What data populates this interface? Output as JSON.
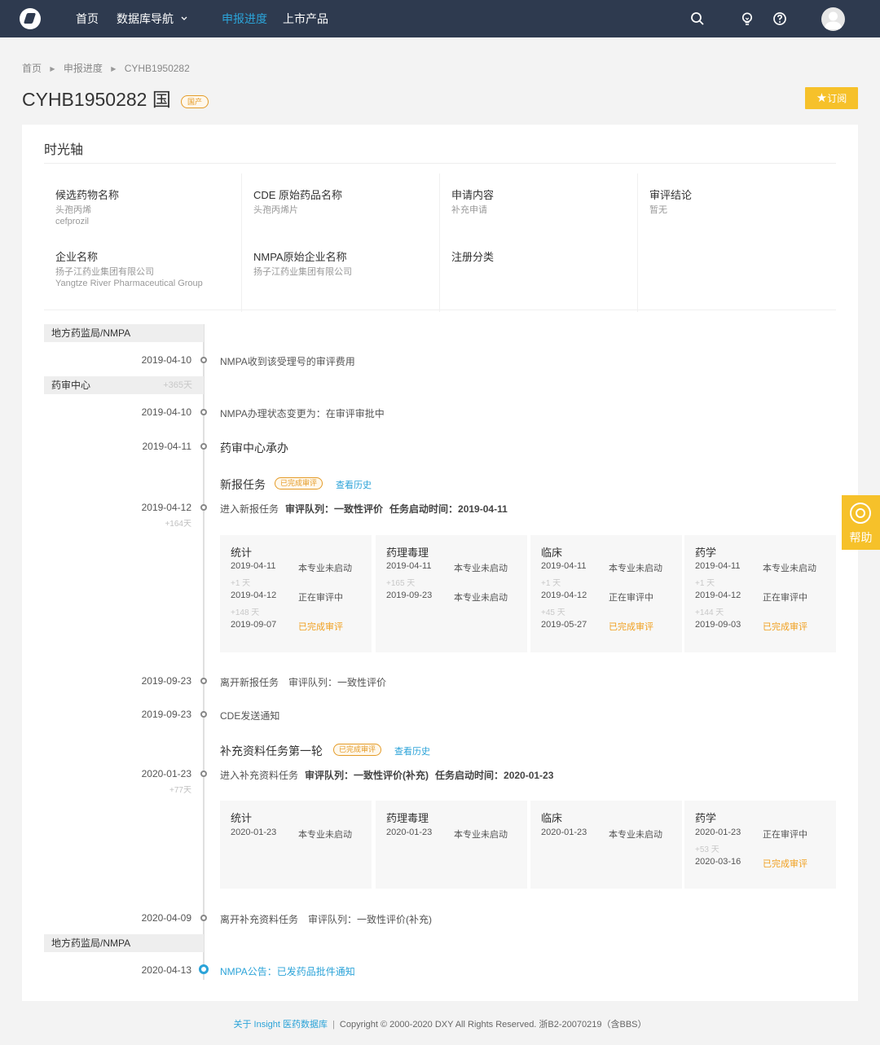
{
  "nav": {
    "items": [
      "首页",
      "数据库导航",
      "申报进度",
      "上市产品"
    ],
    "dropdown_chevron": "chevron-down-icon",
    "active_index": 2,
    "active_color": "#2ba3d8",
    "bg_color": "#2e3a4f",
    "icons": [
      "search-icon",
      "lightbulb-icon",
      "question-icon",
      "avatar"
    ]
  },
  "breadcrumb": [
    "首页",
    "申报进度",
    "CYHB1950282"
  ],
  "title": {
    "main": "CYHB1950282 国",
    "badge": "国产",
    "subscribe_icon": "star-icon",
    "subscribe_label": "订阅"
  },
  "card": {
    "title": "时光轴",
    "info": [
      {
        "label": "候选药物名称",
        "values": [
          "头孢丙烯",
          "cefprozil"
        ]
      },
      {
        "label": "CDE 原始药品名称",
        "values": [
          "头孢丙烯片"
        ]
      },
      {
        "label": "申请内容",
        "values": [
          "补充申请"
        ]
      },
      {
        "label": "审评结论",
        "values": [
          "暂无"
        ]
      },
      {
        "label": "企业名称",
        "values": [
          "扬子江药业集团有限公司",
          "Yangtze River Pharmaceutical Group"
        ]
      },
      {
        "label": "NMPA原始企业名称",
        "values": [
          "扬子江药业集团有限公司"
        ]
      },
      {
        "label": "注册分类",
        "values": []
      }
    ]
  },
  "timeline": {
    "sections": [
      {
        "label": "地方药监局/NMPA"
      },
      {
        "label": "药审中心",
        "extra": "+365天"
      },
      {
        "label": "地方药监局/NMPA"
      }
    ],
    "events": [
      {
        "date": "2019-04-10",
        "text": "NMPA收到该受理号的审评费用"
      },
      {
        "date": "2019-04-10",
        "text": "NMPA办理状态变更为：在审评审批中"
      },
      {
        "date": "2019-04-11",
        "text": "药审中心承办"
      },
      {
        "date": "2019-04-12",
        "sub": "+164天",
        "text": "进入新报任务",
        "b1": "审评队列：一致性评价",
        "b2": "任务启动时间：2019-04-11"
      },
      {
        "date": "2019-09-23",
        "text": "离开新报任务　审评队列：一致性评价"
      },
      {
        "date": "2019-09-23",
        "text": "CDE发送通知"
      },
      {
        "date": "2020-01-23",
        "sub": "+77天",
        "text": "进入补充资料任务",
        "b1": "审评队列：一致性评价(补充)",
        "b2": "任务启动时间：2020-01-23"
      },
      {
        "date": "2020-04-09",
        "text": "离开补充资料任务　审评队列：一致性评价(补充)"
      },
      {
        "date": "2020-04-13",
        "text": "NMPA公告：已发药品批件通知"
      }
    ],
    "tasks": [
      {
        "title": "新报任务",
        "badge": "已完成审评",
        "link": "查看历史",
        "boxes": [
          {
            "name": "统计",
            "rows": [
              {
                "date": "2019-04-11",
                "status": "本专业未启动",
                "sub": "+1 天"
              },
              {
                "date": "2019-04-12",
                "status": "正在审评中",
                "sub": "+148 天"
              },
              {
                "date": "2019-09-07",
                "status": "已完成审评"
              }
            ]
          },
          {
            "name": "药理毒理",
            "rows": [
              {
                "date": "2019-04-11",
                "status": "本专业未启动",
                "sub": "+165 天"
              },
              {
                "date": "2019-09-23",
                "status": "本专业未启动"
              }
            ]
          },
          {
            "name": "临床",
            "rows": [
              {
                "date": "2019-04-11",
                "status": "本专业未启动",
                "sub": "+1 天"
              },
              {
                "date": "2019-04-12",
                "status": "正在审评中",
                "sub": "+45 天"
              },
              {
                "date": "2019-05-27",
                "status": "已完成审评"
              }
            ]
          },
          {
            "name": "药学",
            "rows": [
              {
                "date": "2019-04-11",
                "status": "本专业未启动",
                "sub": "+1 天"
              },
              {
                "date": "2019-04-12",
                "status": "正在审评中",
                "sub": "+144 天"
              },
              {
                "date": "2019-09-03",
                "status": "已完成审评"
              }
            ]
          }
        ]
      },
      {
        "title": "补充资料任务第一轮",
        "badge": "已完成审评",
        "link": "查看历史",
        "boxes": [
          {
            "name": "统计",
            "rows": [
              {
                "date": "2020-01-23",
                "status": "本专业未启动"
              }
            ]
          },
          {
            "name": "药理毒理",
            "rows": [
              {
                "date": "2020-01-23",
                "status": "本专业未启动"
              }
            ]
          },
          {
            "name": "临床",
            "rows": [
              {
                "date": "2020-01-23",
                "status": "本专业未启动"
              }
            ]
          },
          {
            "name": "药学",
            "rows": [
              {
                "date": "2020-01-23",
                "status": "正在审评中",
                "sub": "+53 天"
              },
              {
                "date": "2020-03-16",
                "status": "已完成审评"
              }
            ]
          }
        ]
      }
    ]
  },
  "help": {
    "icon": "help-icon",
    "label": "帮助"
  },
  "footer": {
    "link": "关于 Insight 医药数据库",
    "separator": "|",
    "text": "Copyright © 2000-2020 DXY All Rights Reserved. 浙B2-20070219（含BBS）"
  },
  "colors": {
    "accent": "#2ba3d8",
    "gold": "#f6c12a",
    "done": "#f0a020",
    "badge": "#e49b27"
  }
}
